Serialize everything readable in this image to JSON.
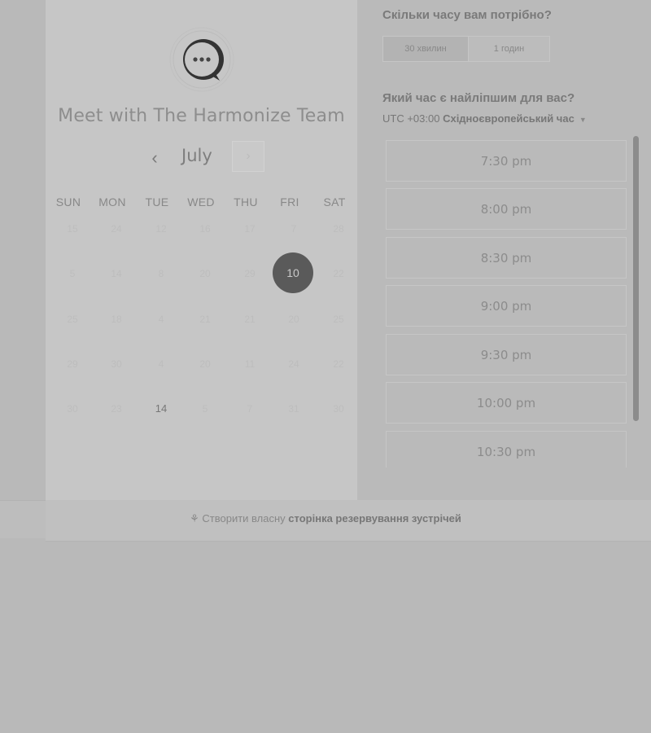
{
  "header": {
    "team_title": "Meet with The Harmonize Team"
  },
  "calendar": {
    "month": "July",
    "prev_icon": "‹",
    "next_icon": "›",
    "weekdays": [
      "SUN",
      "MON",
      "TUE",
      "WED",
      "THU",
      "FRI",
      "SAT"
    ],
    "weeks": [
      [
        "15",
        "24",
        "12",
        "16",
        "17",
        "7",
        "28"
      ],
      [
        "5",
        "14",
        "8",
        "20",
        "29",
        "10",
        "22"
      ],
      [
        "25",
        "18",
        "4",
        "21",
        "21",
        "20",
        "25"
      ],
      [
        "29",
        "30",
        "4",
        "20",
        "11",
        "24",
        "22"
      ],
      [
        "30",
        "23",
        "14",
        "5",
        "7",
        "31",
        "30"
      ]
    ],
    "selected_day": "10",
    "available_day": "14"
  },
  "duration": {
    "question": "Скільки часу вам потрібно?",
    "options": [
      "30 хвилин",
      "1 годин"
    ],
    "selected_index": 0
  },
  "time": {
    "question": "Який час є найліпшим для вас?",
    "tz_prefix": "UTC +03:00",
    "tz_name": "Східноєвропейський час",
    "slots": [
      "7:30 pm",
      "8:00 pm",
      "8:30 pm",
      "9:00 pm",
      "9:30 pm",
      "10:00 pm",
      "10:30 pm"
    ]
  },
  "footer": {
    "prefix": "Створити власну",
    "bold": "сторінка резервування зустрічей"
  },
  "colors": {
    "selected_day_bg": "#5a5a5a",
    "panel_bg": "#c6c6c6",
    "overlay_bg": "#b9b9b9"
  },
  "icons": {
    "logo": "chat-bubble-logo-icon",
    "footer": "hubspot-sprocket-icon",
    "tz": "caret-down-icon"
  }
}
